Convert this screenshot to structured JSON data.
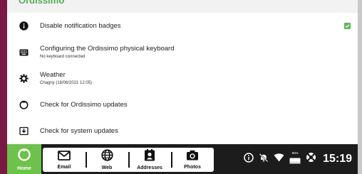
{
  "header": {
    "partial_title": "Ordissimo"
  },
  "settings": {
    "rows": [
      {
        "icon": "info-icon",
        "title": "Disable notification badges",
        "subtitle": "",
        "checked": true
      },
      {
        "icon": "keyboard-icon",
        "title": "Configuring the Ordissimo physical keyboard",
        "subtitle": "No keyboard connected"
      },
      {
        "icon": "gear-icon",
        "title": "Weather",
        "subtitle": "Chagny (18/06/2021 12:05)"
      },
      {
        "icon": "ordissimo-update-icon",
        "title": "Check for Ordissimo updates",
        "subtitle": ""
      },
      {
        "icon": "system-update-icon",
        "title": "Check for system updates",
        "subtitle": ""
      }
    ]
  },
  "taskbar": {
    "home_label": "Home",
    "apps": [
      {
        "icon": "envelope-icon",
        "label": "Email"
      },
      {
        "icon": "globe-icon",
        "label": "Web"
      },
      {
        "icon": "contact-card-icon",
        "label": "Addresses"
      },
      {
        "icon": "camera-icon",
        "label": "Photos"
      }
    ],
    "status": {
      "battery_percent": "90%",
      "time": "15:19"
    }
  },
  "colors": {
    "accent_green": "#6cc24a",
    "frame_left": "#7a1a44",
    "taskbar_bg": "#1c1c1c"
  }
}
